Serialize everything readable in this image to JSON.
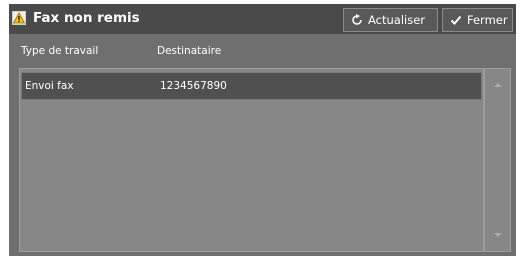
{
  "dialog": {
    "title": "Fax non remis",
    "title_icon": "warning-icon"
  },
  "toolbar": {
    "refresh_label": "Actualiser",
    "refresh_icon": "refresh-icon",
    "close_label": "Fermer",
    "close_icon": "checkmark-icon"
  },
  "table": {
    "columns": [
      "Type de travail",
      "Destinataire"
    ],
    "rows": [
      {
        "type": "Envoi fax",
        "recipient": "1234567890",
        "selected": true
      }
    ]
  },
  "colors": {
    "panel": "#6f6f6f",
    "titlebar": "#4a4a4a",
    "list_bg": "#878787",
    "selected_row": "#505050",
    "warning": "#f5c400"
  }
}
